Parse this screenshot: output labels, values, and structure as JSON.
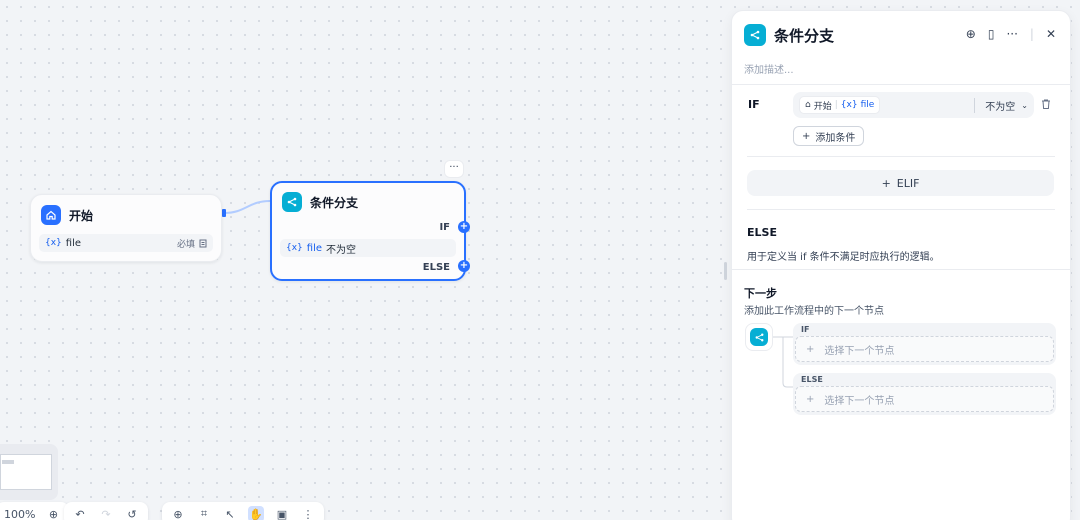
{
  "canvas": {
    "start_node": {
      "title": "开始",
      "var_symbol": "{x}",
      "var_name": "file",
      "required_label": "必填"
    },
    "if_node": {
      "title": "条件分支",
      "if_label": "IF",
      "else_label": "ELSE",
      "var_symbol": "{x}",
      "var_name": "file",
      "operator": "不为空"
    },
    "more_label": "···"
  },
  "toolbar": {
    "zoom": "100%"
  },
  "panel": {
    "title": "条件分支",
    "description_placeholder": "添加描述...",
    "if_label": "IF",
    "condition": {
      "source": "开始",
      "var_symbol": "{x}",
      "var_name": "file",
      "operator": "不为空"
    },
    "add_condition_label": "添加条件",
    "elif_label": "ELIF",
    "else": {
      "label": "ELSE",
      "description": "用于定义当 if 条件不满足时应执行的逻辑。"
    },
    "next_step": {
      "title": "下一步",
      "description": "添加此工作流程中的下一个节点",
      "branches": [
        {
          "label": "IF",
          "placeholder": "选择下一个节点"
        },
        {
          "label": "ELSE",
          "placeholder": "选择下一个节点"
        }
      ]
    }
  },
  "colors": {
    "accent": "#2970ff",
    "teal": "#06aed4"
  }
}
